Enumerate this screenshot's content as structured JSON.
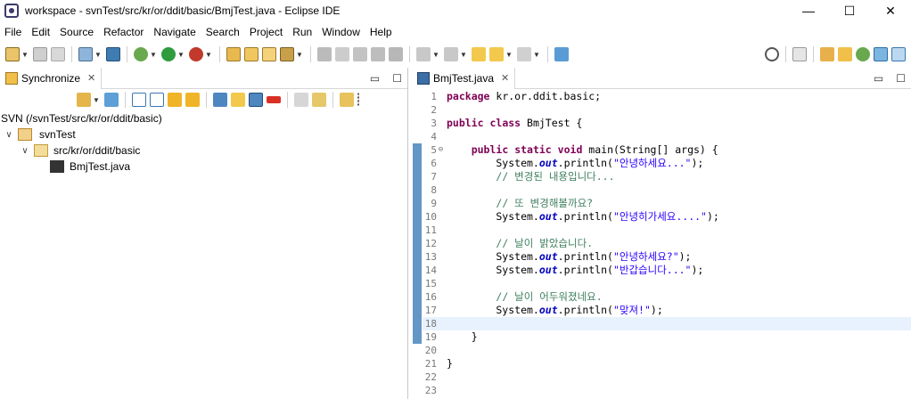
{
  "window": {
    "title": "workspace - svnTest/src/kr/or/ddit/basic/BmjTest.java - Eclipse IDE",
    "minimize": "—",
    "maximize": "☐",
    "close": "✕"
  },
  "menu": [
    "File",
    "Edit",
    "Source",
    "Refactor",
    "Navigate",
    "Search",
    "Project",
    "Run",
    "Window",
    "Help"
  ],
  "left_panel": {
    "tab_label": "Synchronize",
    "tab_close": "✕",
    "minimize": "▭",
    "maximize": "☐",
    "path": "SVN (/svnTest/src/kr/or/ddit/basic)",
    "tree": {
      "project": "svnTest",
      "package": "src/kr/or/ddit/basic",
      "file": "BmjTest.java"
    }
  },
  "editor": {
    "tab_label": "BmjTest.java",
    "tab_close": "✕",
    "minimize": "▭",
    "maximize": "☐",
    "lines": [
      {
        "n": "1",
        "code": "package kr.or.ddit.basic;"
      },
      {
        "n": "2",
        "code": ""
      },
      {
        "n": "3",
        "code": "public class BmjTest {"
      },
      {
        "n": "4",
        "code": ""
      },
      {
        "n": "5",
        "code": "    public static void main(String[] args) {"
      },
      {
        "n": "6",
        "code": "        System.out.println(\"안녕하세요...\");"
      },
      {
        "n": "7",
        "code": "        // 변경된 내용입니다..."
      },
      {
        "n": "8",
        "code": ""
      },
      {
        "n": "9",
        "code": "        // 또 변경해볼까요?"
      },
      {
        "n": "10",
        "code": "        System.out.println(\"안녕히가세요....\");"
      },
      {
        "n": "11",
        "code": ""
      },
      {
        "n": "12",
        "code": "        // 날이 밝았습니다."
      },
      {
        "n": "13",
        "code": "        System.out.println(\"안녕하세요?\");"
      },
      {
        "n": "14",
        "code": "        System.out.println(\"반갑습니다...\");"
      },
      {
        "n": "15",
        "code": ""
      },
      {
        "n": "16",
        "code": "        // 날이 어두워졌네요."
      },
      {
        "n": "17",
        "code": "        System.out.println(\"맞져!\");"
      },
      {
        "n": "18",
        "code": ""
      },
      {
        "n": "19",
        "code": "    }"
      },
      {
        "n": "20",
        "code": ""
      },
      {
        "n": "21",
        "code": "}"
      },
      {
        "n": "22",
        "code": ""
      },
      {
        "n": "23",
        "code": ""
      }
    ],
    "fold_marker": "⊖",
    "current_line": 18
  },
  "colors": {
    "keyword": "#7f0055",
    "comment": "#3f7f5f",
    "string": "#2a00ff",
    "static_field": "#0000c0",
    "current_line_bg": "#e8f2fe",
    "change_ruler": "#6497c6"
  }
}
